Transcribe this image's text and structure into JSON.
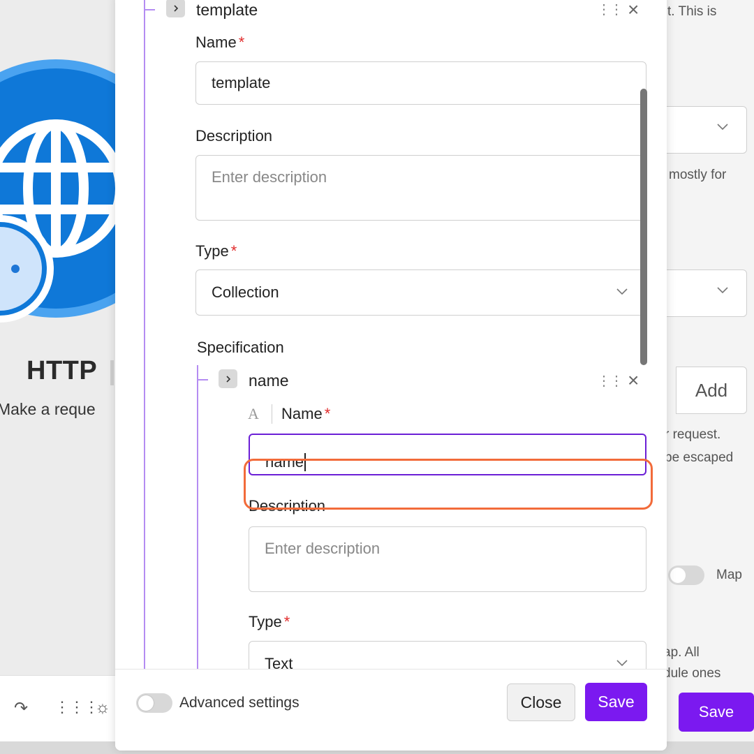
{
  "background": {
    "module_title": "HTTP",
    "module_subtitle": "Make a reque",
    "right_texts": [
      "t. This is",
      "mostly for",
      "r request.",
      "be escaped",
      "Map",
      "ap. All",
      "dule ones"
    ],
    "add_button_label": "Add",
    "save_button_label": "Save",
    "toolbar_icons": [
      "redo-icon",
      "apps-grid-icon",
      "lightbulb-icon"
    ]
  },
  "modal": {
    "item": {
      "title": "template",
      "name_label": "Name",
      "name_value": "template",
      "description_label": "Description",
      "description_placeholder": "Enter description",
      "type_label": "Type",
      "type_value": "Collection",
      "specification_label": "Specification"
    },
    "sub_item": {
      "title": "name",
      "type_glyph": "A",
      "name_label": "Name",
      "name_value": "name",
      "description_label": "Description",
      "description_placeholder": "Enter description",
      "type_label": "Type",
      "type_value": "Text"
    },
    "required_marker": "*",
    "footer": {
      "advanced_settings_label": "Advanced settings",
      "close_label": "Close",
      "save_label": "Save"
    }
  },
  "colors": {
    "accent": "#7b19f0",
    "focus_border": "#6b1fd6",
    "highlight": "#f26b3a",
    "tree_line": "#b48cf2",
    "required": "#e12c2c"
  }
}
